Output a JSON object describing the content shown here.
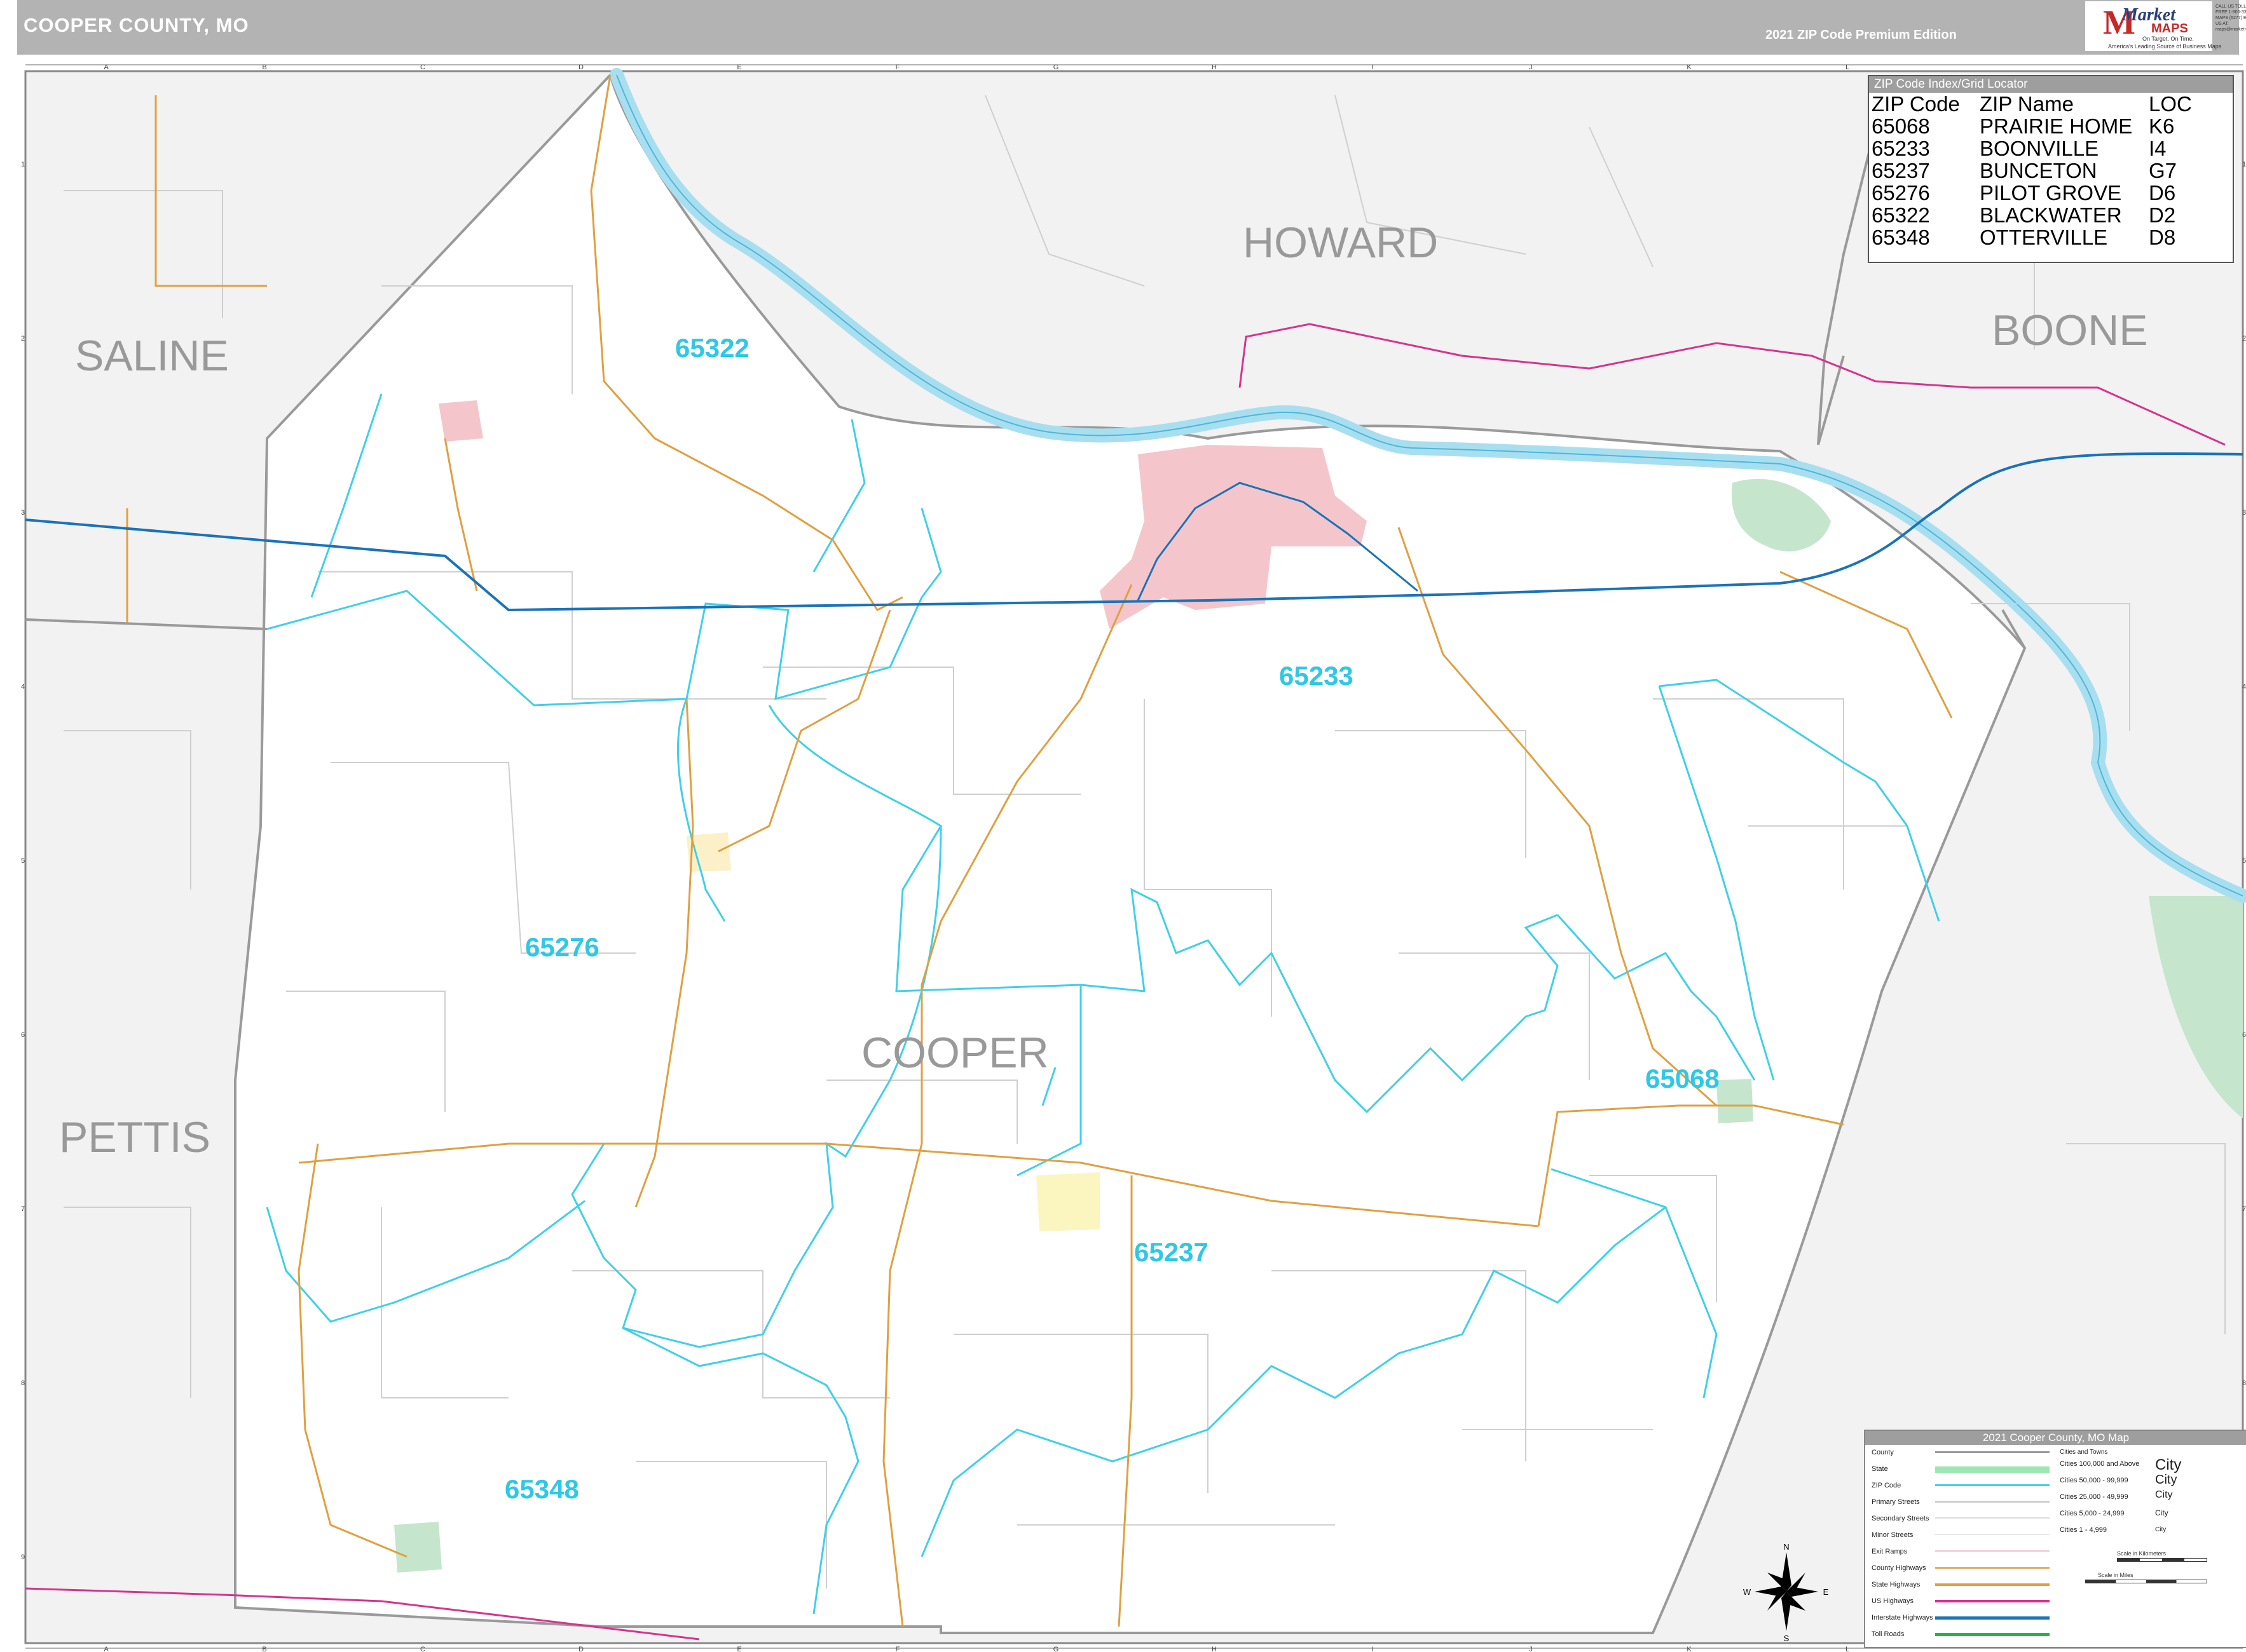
{
  "header": {
    "title": "COOPER COUNTY, MO",
    "edition": "2021 ZIP Code Premium Edition"
  },
  "logo": {
    "market": "Market",
    "maps": "MAPS",
    "tagline": "On Target.  On Time.",
    "tagline2": "America's Leading Source of Business Maps",
    "contact": "CALL US TOLL FREE 1-800-334-MAPS (6277) EMAIL US AT: maps@marketmaps.com"
  },
  "grid": {
    "columns": [
      "A",
      "B",
      "C",
      "D",
      "E",
      "F",
      "G",
      "H",
      "I",
      "J",
      "K",
      "L"
    ],
    "rows": [
      "1",
      "2",
      "3",
      "4",
      "5",
      "6",
      "7",
      "8",
      "9"
    ]
  },
  "counties": {
    "saline": "SALINE",
    "howard": "HOWARD",
    "boone": "BOONE",
    "pettis": "PETTIS",
    "cooper": "COOPER"
  },
  "zip_labels": [
    "65322",
    "65233",
    "65276",
    "65068",
    "65237",
    "65348"
  ],
  "zip_index": {
    "title": "ZIP Code Index/Grid Locator",
    "headers": [
      "ZIP Code",
      "ZIP Name",
      "LOC"
    ],
    "rows": [
      [
        "65068",
        "PRAIRIE HOME",
        "K6"
      ],
      [
        "65233",
        "BOONVILLE",
        "I4"
      ],
      [
        "65237",
        "BUNCETON",
        "G7"
      ],
      [
        "65276",
        "PILOT GROVE",
        "D6"
      ],
      [
        "65322",
        "BLACKWATER",
        "D2"
      ],
      [
        "65348",
        "OTTERVILLE",
        "D8"
      ]
    ]
  },
  "legend": {
    "title": "2021 Cooper County, MO Map",
    "items": [
      "County",
      "State",
      "ZIP Code",
      "Primary Streets",
      "Secondary Streets",
      "Minor Streets",
      "Exit Ramps",
      "County Highways",
      "State Highways",
      "US Highways",
      "Interstate Highways",
      "Toll Roads"
    ],
    "cities_title": "Cities and Towns",
    "cities": [
      {
        "label": "Cities 100,000 and Above",
        "sample": "City"
      },
      {
        "label": "Cities 50,000 - 99,999",
        "sample": "City"
      },
      {
        "label": "Cities 25,000 - 49,999",
        "sample": "City"
      },
      {
        "label": "Cities 5,000 - 24,999",
        "sample": "City"
      },
      {
        "label": "Cities 1 - 4,999",
        "sample": "City"
      }
    ],
    "scale_km": "Scale in Kilometers",
    "scale_mi": "Scale in Miles"
  },
  "compass": {
    "n": "N",
    "s": "S",
    "e": "E",
    "w": "W"
  },
  "colors": {
    "river": "#a8dff0",
    "zip_boundary": "#3fd0e8",
    "interstate": "#1a73b8",
    "us_highway": "#d6338f",
    "state_highway": "#e0a040",
    "county_line": "#9a9a9a",
    "boonville": "#f4c6cc",
    "wildlife_area": "#c5e6cc",
    "outside_fill": "#f2f2f2"
  }
}
